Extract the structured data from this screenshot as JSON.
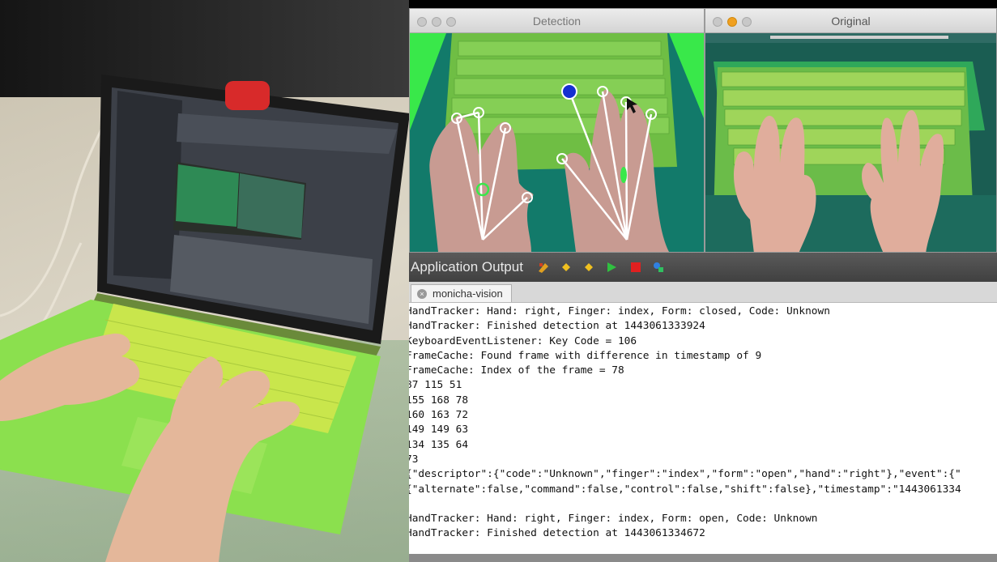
{
  "windows": {
    "detection": {
      "title": "Detection"
    },
    "original": {
      "title": "Original"
    }
  },
  "app_output": {
    "header_label": "Application Output",
    "tab_label": "monicha-vision",
    "toolbar_icons": [
      "attach-icon",
      "prev-icon",
      "next-icon",
      "run-icon",
      "stop-icon",
      "settings-icon"
    ],
    "lines": [
      "HandTracker: Hand: right, Finger: index, Form: closed, Code: Unknown",
      "HandTracker: Finished detection at 1443061333924",
      "KeyboardEventListener: Key Code = 106",
      "FrameCache: Found frame with difference in timestamp of 9",
      "FrameCache: Index of the frame = 78",
      "87 115 51",
      "155 168 78",
      "160 163 72",
      "149 149 63",
      "134 135 64",
      "73",
      "{\"descriptor\":{\"code\":\"Unknown\",\"finger\":\"index\",\"form\":\"open\",\"hand\":\"right\"},\"event\":{\"",
      "{\"alternate\":false,\"command\":false,\"control\":false,\"shift\":false},\"timestamp\":\"1443061334",
      "",
      "HandTracker: Hand: right, Finger: index, Form: open, Code: Unknown",
      "HandTracker: Finished detection at 1443061334672"
    ]
  },
  "colors": {
    "keyboard_green": "#7ed44a",
    "hand_skin": "#d9a08e",
    "laptop_shell": "#8be04e",
    "tracker_blue": "#1530d0"
  }
}
